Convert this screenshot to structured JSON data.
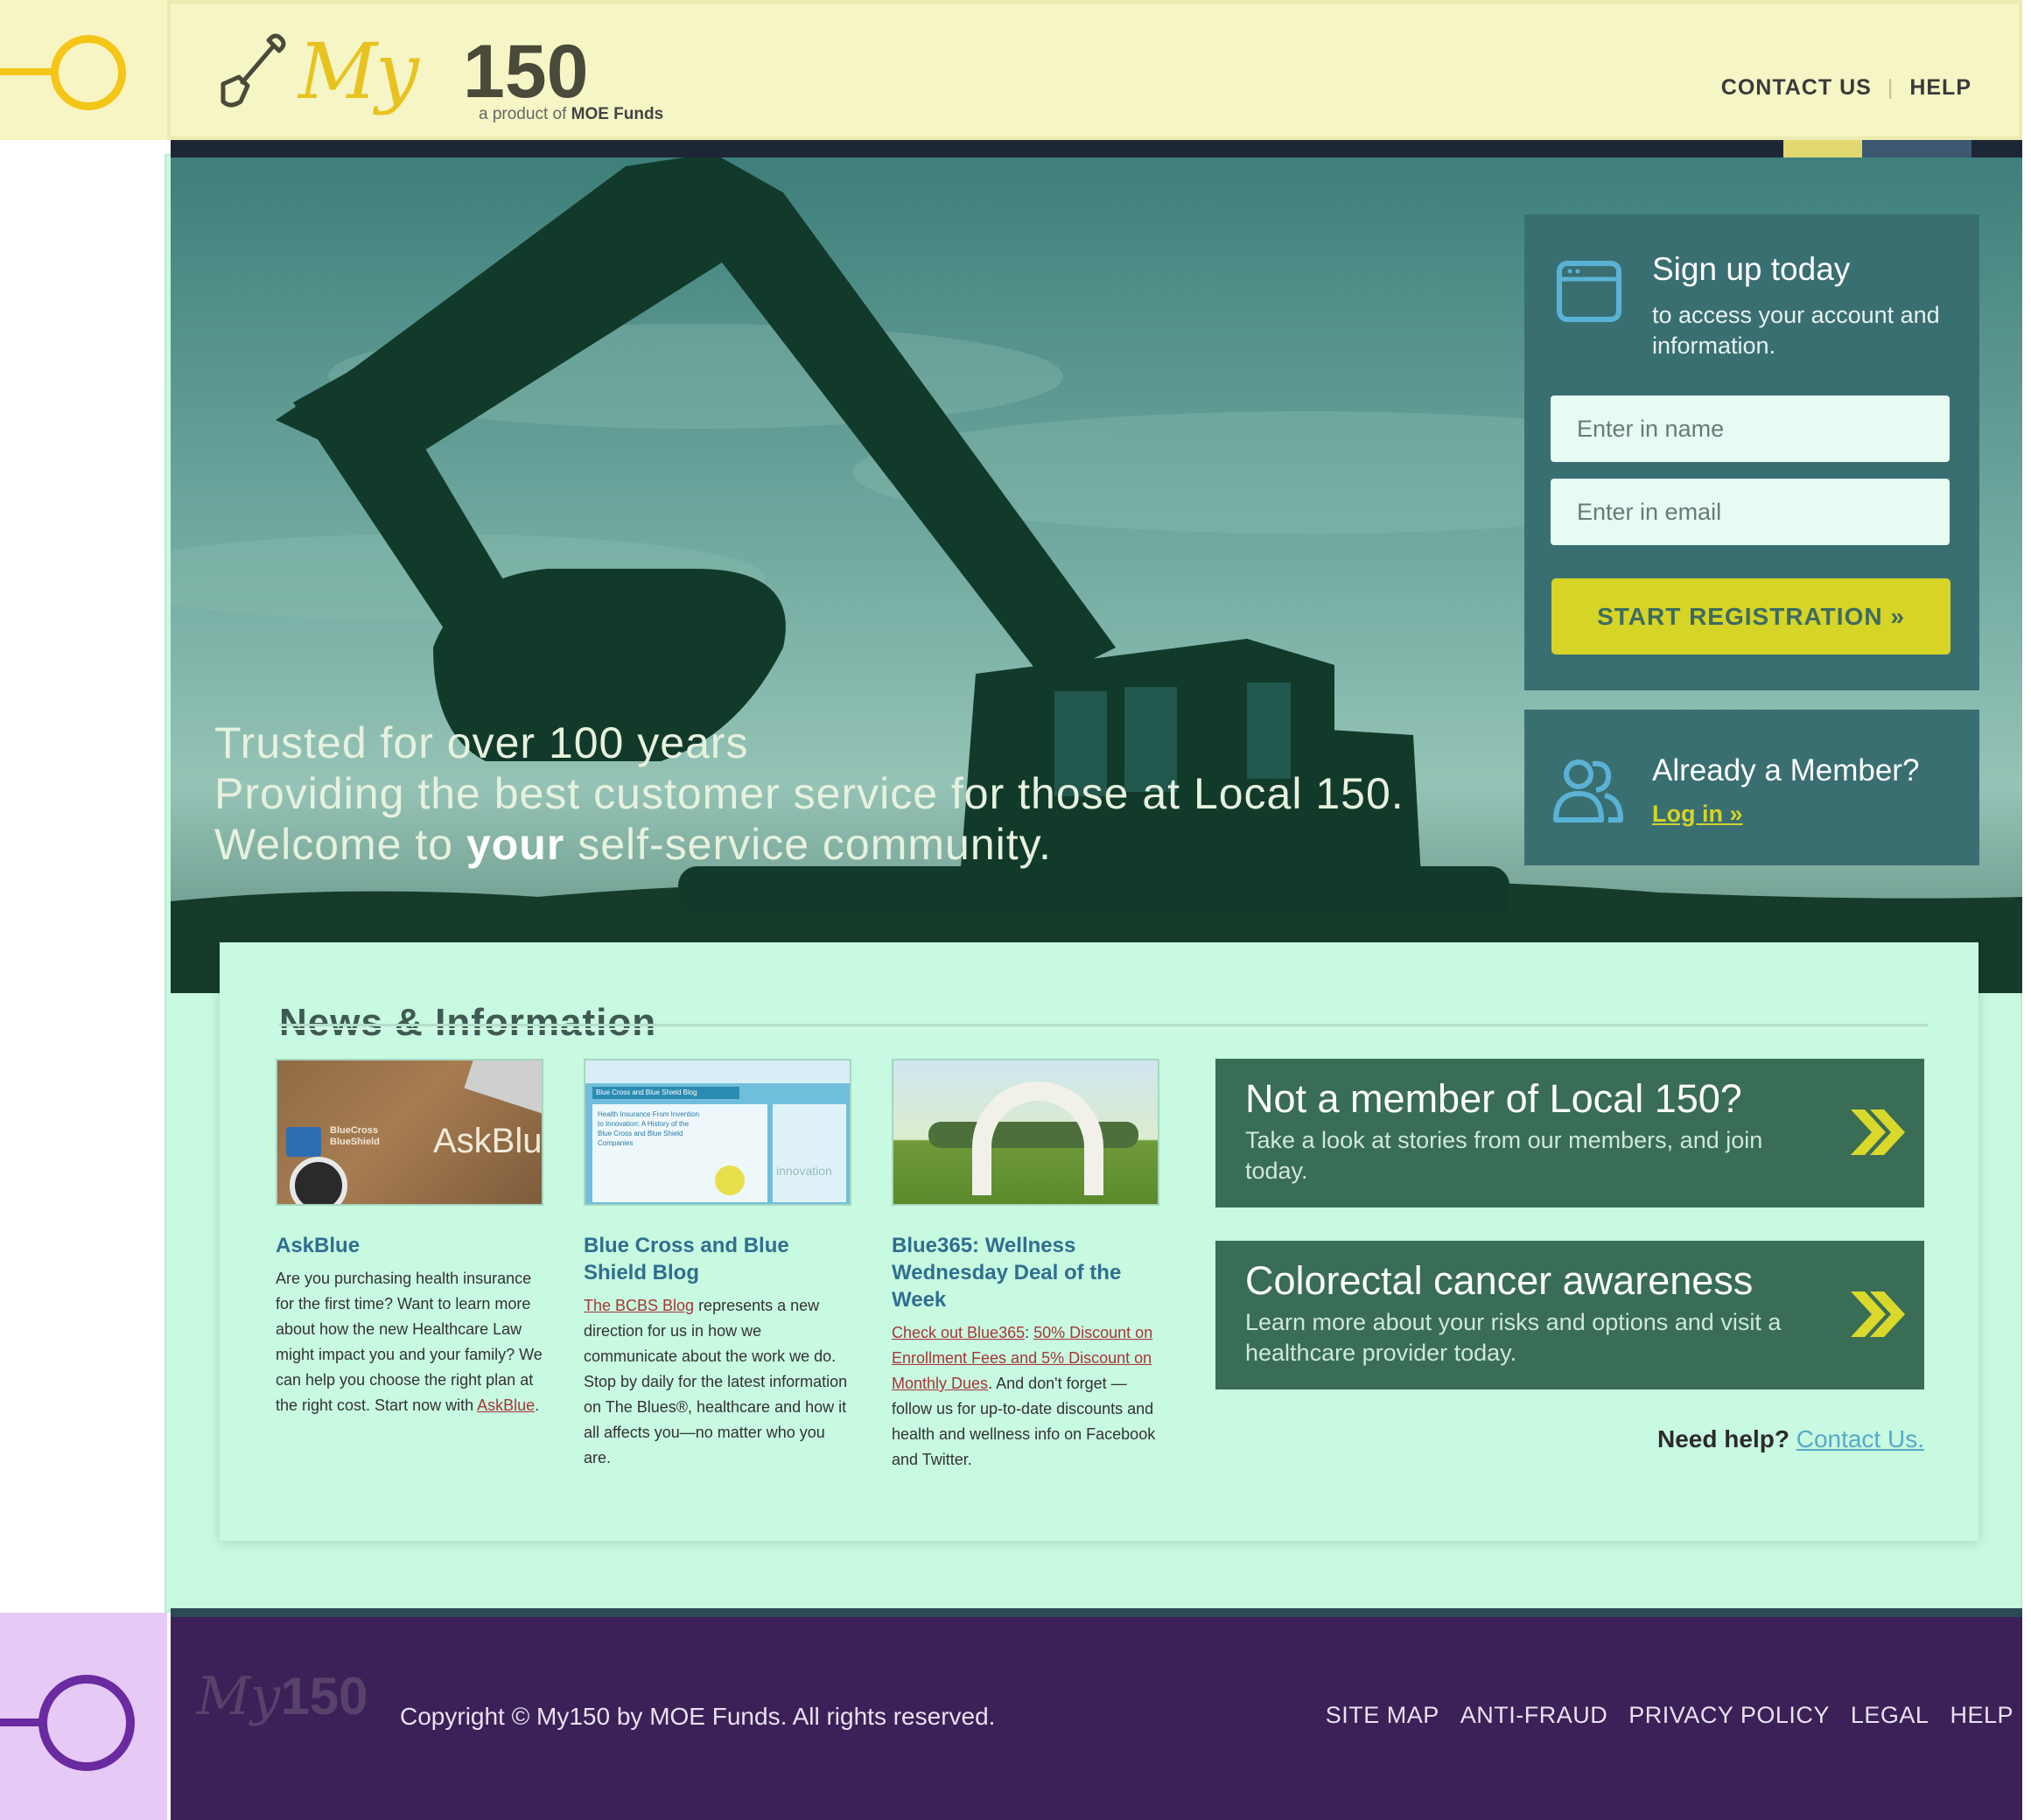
{
  "header": {
    "logo_script": "My",
    "logo_number": "150",
    "logo_tagline_prefix": "a product of",
    "logo_tagline_brand": "MOE Funds",
    "nav": {
      "contact": "CONTACT US",
      "separator": "|",
      "help": "HELP"
    }
  },
  "hero": {
    "line1": "Trusted for over 100 years",
    "line2": "Providing the best customer service for those at Local 150.",
    "line3_prefix": "Welcome to ",
    "line3_emphasis": "your",
    "line3_suffix": " self-service community."
  },
  "signup": {
    "title": "Sign up today",
    "subtitle": "to access your account and information.",
    "name_placeholder": "Enter in name",
    "email_placeholder": "Enter in email",
    "button_label": "START REGISTRATION »"
  },
  "member": {
    "title": "Already a Member?",
    "login_link": "Log in »"
  },
  "news": {
    "heading": "News & Information",
    "articles": [
      {
        "title": "AskBlue",
        "thumb_text": "AskBlue",
        "thumb_badge": "BlueCross BlueShield",
        "body": "Are you purchasing health insurance for the first time?  Want to learn more about how the new Healthcare Law might impact you and your family?  We can help you choose the right plan at the right cost.  Start now with ",
        "link": "AskBlue",
        "body_end": "."
      },
      {
        "title": "Blue Cross and Blue Shield Blog",
        "thumb_header": "Blue Cross and Blue Shield Blog",
        "thumb_text": "Health Insurance From Invention to Innovation: A History of the Blue Cross and Blue Shield Companies",
        "thumb_tag": "innovation",
        "link": "The BCBS Blog",
        "body": " represents a new direction for us in how we communicate about the work we do. Stop by daily for the latest information on The Blues®, healthcare and how it all affects you—no matter who you are."
      },
      {
        "title": "Blue365: Wellness Wednesday Deal of the Week",
        "link_prefix": "Check out Blue365",
        "link": "50% Discount on Enrollment Fees and 5% Discount on Monthly Dues",
        "body": ". And don't forget — follow us for up-to-date discounts and health and wellness info on Facebook and Twitter."
      }
    ],
    "promos": [
      {
        "title": "Not a member of Local 150?",
        "body": "Take a look at stories from our members, and join today."
      },
      {
        "title": "Colorectal cancer awareness",
        "body": "Learn more about your risks and options and visit a healthcare provider today."
      }
    ],
    "need_help_label": "Need help?",
    "need_help_link": "Contact Us."
  },
  "footer": {
    "logo_script": "My",
    "logo_number": "150",
    "copyright": "Copyright © My150 by MOE Funds. All rights reserved.",
    "nav": [
      "SITE MAP",
      "ANTI-FRAUD",
      "PRIVACY POLICY",
      "LEGAL",
      "HELP"
    ]
  },
  "colors": {
    "header_bg": "#f5f5c6",
    "main_bg": "#c8f9e1",
    "footer_bg": "#3b2157",
    "accent_yellow": "#d5d427",
    "panel_teal": "#3a6f72",
    "promo_green": "#396d55",
    "marker_yellow": "#f5c518",
    "marker_purple": "#6a2aa0"
  },
  "icons": {
    "logo": "shovel-icon",
    "signup": "browser-window-icon",
    "member": "users-icon",
    "promo": "double-chevron-right-icon",
    "annotation_top": "circle-marker-icon",
    "annotation_bottom": "circle-marker-icon"
  }
}
